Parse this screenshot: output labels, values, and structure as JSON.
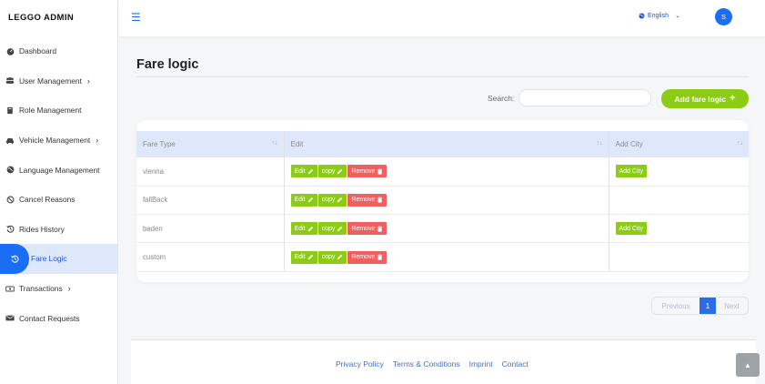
{
  "sidebar": {
    "brand": "LEGGO ADMIN",
    "items": [
      {
        "label": "Dashboard",
        "icon": "dashboard-icon"
      },
      {
        "label": "User Management",
        "icon": "users-icon",
        "expandable": true
      },
      {
        "label": "Role Management",
        "icon": "book-icon"
      },
      {
        "label": "Vehicle Management",
        "icon": "car-icon",
        "expandable": true
      },
      {
        "label": "Language Management",
        "icon": "globe-icon"
      },
      {
        "label": "Cancel Reasons",
        "icon": "ban-icon"
      },
      {
        "label": "Rides History",
        "icon": "history-icon"
      },
      {
        "label": "Fare Logic",
        "icon": "history-icon",
        "active": true
      },
      {
        "label": "Transactions",
        "icon": "money-icon",
        "expandable": true
      },
      {
        "label": "Contact Requests",
        "icon": "envelope-icon"
      }
    ]
  },
  "topbar": {
    "language": "English",
    "avatar_initial": "S"
  },
  "main": {
    "title": "Fare logic",
    "search_label": "Search:",
    "search_value": "",
    "add_button": "Add fare logic"
  },
  "table": {
    "columns": [
      "Fare Type",
      "Edit",
      "Add City"
    ],
    "action_labels": {
      "edit": "Edit",
      "copy": "copy",
      "remove": "Remove",
      "add_city": "Add City"
    },
    "rows": [
      {
        "fare_type": "vienna",
        "add_city": true
      },
      {
        "fare_type": "fallBack",
        "add_city": false
      },
      {
        "fare_type": "baden",
        "add_city": true
      },
      {
        "fare_type": "custom",
        "add_city": false
      }
    ]
  },
  "pagination": {
    "previous": "Previous",
    "current": "1",
    "next": "Next"
  },
  "footer": {
    "links": [
      "Privacy Policy",
      "Terms & Conditions",
      "Imprint",
      "Contact"
    ]
  },
  "colors": {
    "accent_blue": "#1a6ef5",
    "green": "#8dcc14",
    "red": "#ef6060",
    "header_row": "#dfe8fb"
  }
}
